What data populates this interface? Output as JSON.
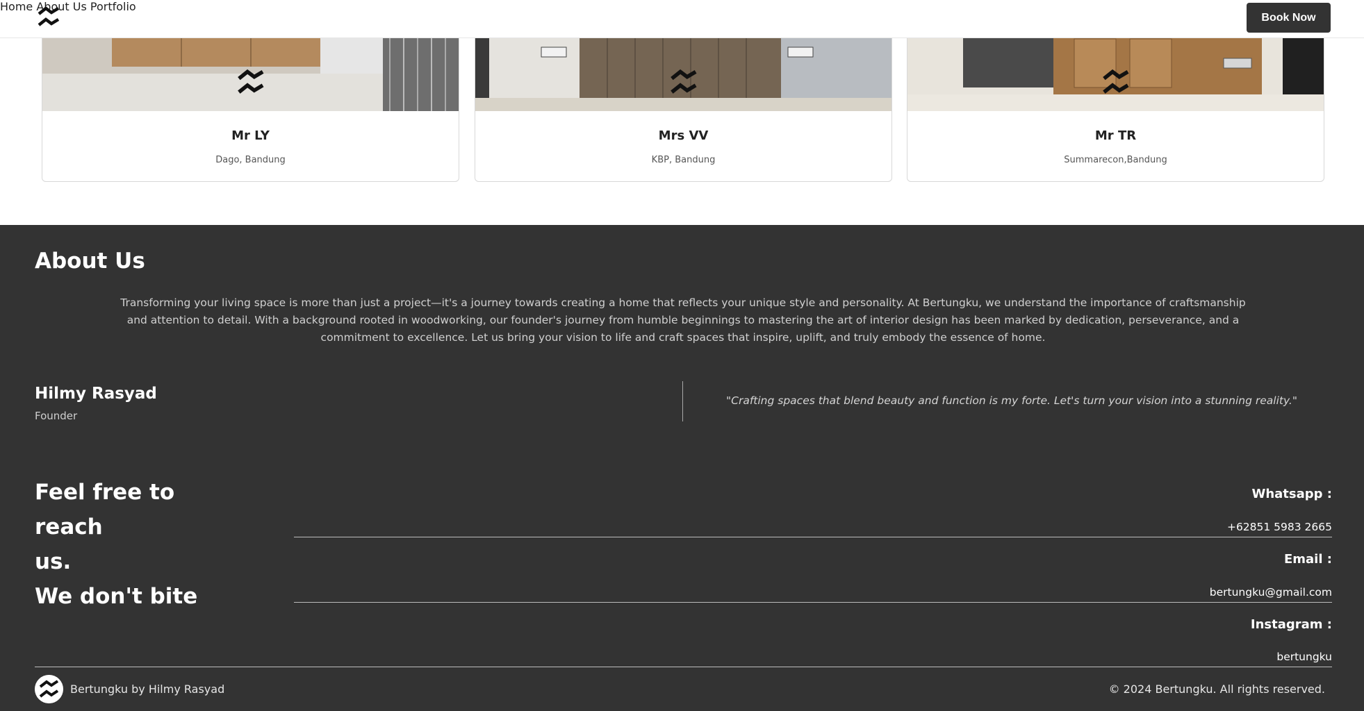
{
  "header": {
    "nav": [
      "Home",
      "About Us",
      "Portfolio"
    ],
    "cta": "Book Now"
  },
  "cards": [
    {
      "name": "Mr LY",
      "location": "Dago, Bandung"
    },
    {
      "name": "Mrs VV",
      "location": "KBP, Bandung"
    },
    {
      "name": "Mr TR",
      "location": "Summarecon,Bandung"
    }
  ],
  "about": {
    "title": "About Us",
    "text": "Transforming your living space is more than just a project—it's a journey towards creating a home that reflects your unique style and personality. At Bertungku, we understand the importance of craftsmanship and attention to detail. With a background rooted in woodworking, our founder's journey from humble beginnings to mastering the art of interior design has been marked by dedication, perseverance, and a commitment to excellence. Let us bring your vision to life and craft spaces that inspire, uplift, and truly embody the essence of home.",
    "founder_name": "Hilmy Rasyad",
    "founder_role": "Founder",
    "quote": "\"Crafting spaces that blend beauty and function is my forte. Let's turn your vision into a stunning reality.\""
  },
  "contact": {
    "heading_line1": "Feel free to reach",
    "heading_line2": "us.",
    "heading_line3": "We don't bite",
    "whatsapp_label": "Whatsapp :",
    "whatsapp_value": "+62851 5983 2665",
    "email_label": "Email :",
    "email_value": "bertungku@gmail.com",
    "instagram_label": "Instagram :",
    "instagram_value": "bertungku"
  },
  "footer": {
    "brand": "Bertungku by Hilmy Rasyad",
    "copyright": "© 2024 Bertungku. All rights reserved."
  },
  "colors": {
    "dark_bg": "#333333",
    "accent": "#333333"
  }
}
